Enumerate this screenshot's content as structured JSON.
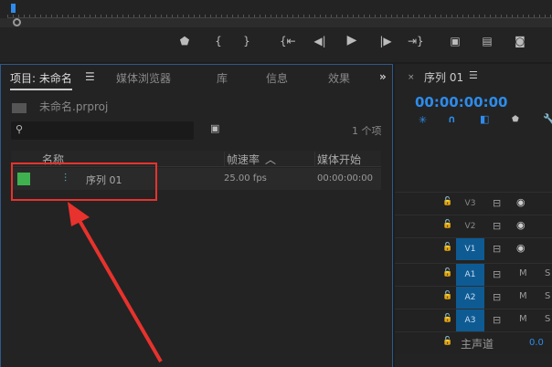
{
  "program_monitor": {
    "controls": [
      "marker-icon",
      "mark-in-icon",
      "mark-out-icon",
      "go-to-in-icon",
      "step-back-icon",
      "play-icon",
      "step-forward-icon",
      "go-to-out-icon",
      "insert-icon",
      "overwrite-icon",
      "export-frame-icon"
    ]
  },
  "project_panel": {
    "tabs": [
      "项目: 未命名",
      "媒体浏览器",
      "库",
      "信息",
      "效果"
    ],
    "file": "未命名.prproj",
    "item_count": "1 个项",
    "columns": [
      "名称",
      "帧速率",
      "媒体开始"
    ],
    "rows": [
      {
        "name": "序列 01",
        "frame_rate": "25.00 fps",
        "media_start": "00:00:00:00",
        "label_color": "#3fb24f"
      }
    ]
  },
  "timeline": {
    "title": "序列 01",
    "timecode": "00:00:00:00",
    "tracks": [
      {
        "label": "V3",
        "type": "video",
        "active": false
      },
      {
        "label": "V2",
        "type": "video",
        "active": false
      },
      {
        "label": "V1",
        "type": "video",
        "active": true
      },
      {
        "label": "A1",
        "type": "audio",
        "active": true,
        "m": "M",
        "s": "S"
      },
      {
        "label": "A2",
        "type": "audio",
        "active": true,
        "m": "M",
        "s": "S"
      },
      {
        "label": "A3",
        "type": "audio",
        "active": true,
        "m": "M",
        "s": "S"
      }
    ],
    "master": {
      "label": "主声道",
      "value": "0.0"
    }
  },
  "colors": {
    "accent": "#2d8ceb",
    "annotation": "#e8322d"
  }
}
